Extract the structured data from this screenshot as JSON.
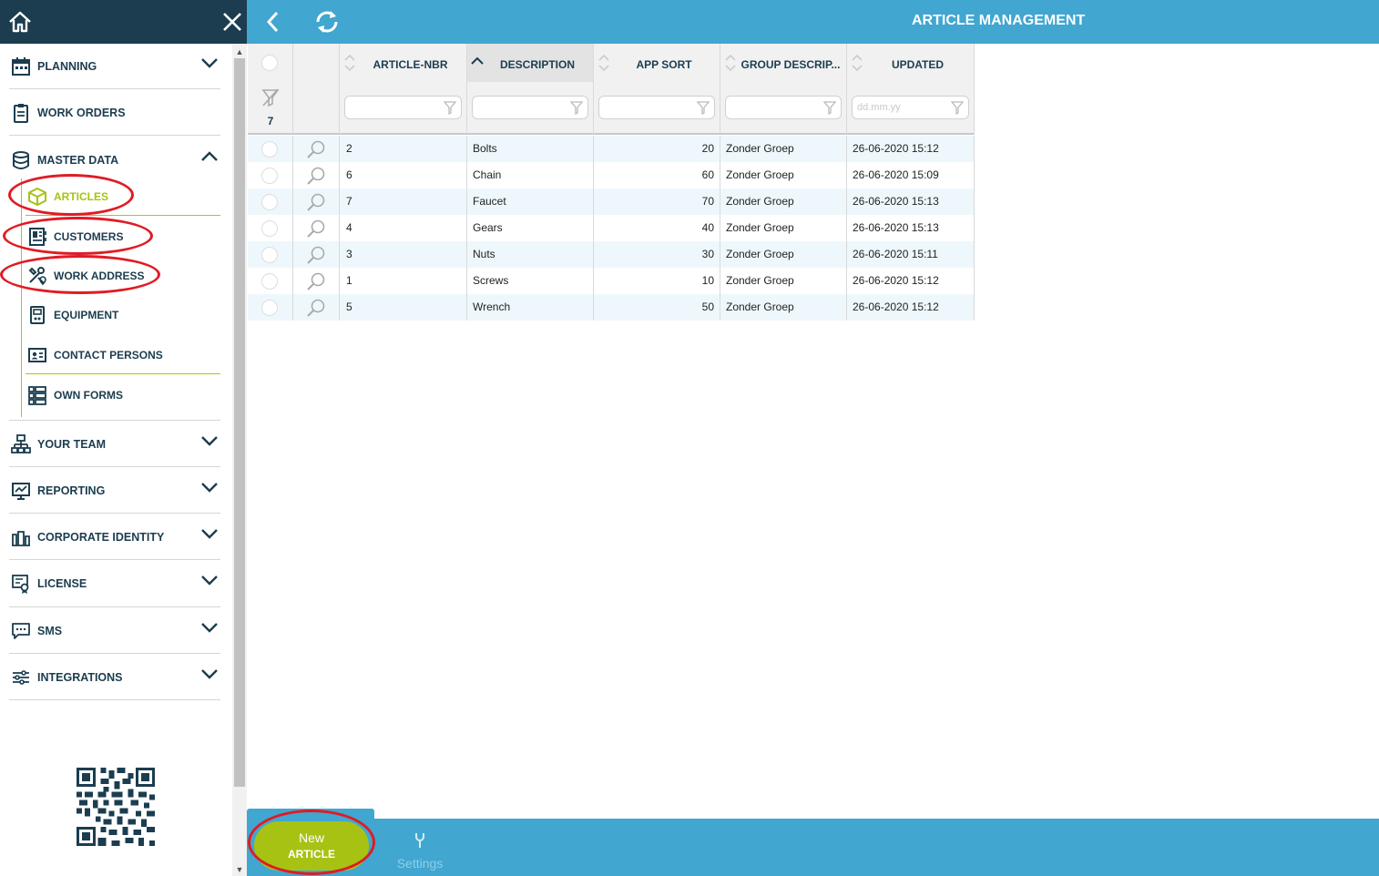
{
  "sidebar": {
    "items": [
      {
        "label": "PLANNING",
        "icon": "calendar-icon",
        "expandable": true
      },
      {
        "label": "WORK ORDERS",
        "icon": "clipboard-icon",
        "expandable": false
      },
      {
        "label": "MASTER DATA",
        "icon": "database-icon",
        "expanded": true,
        "children": [
          {
            "label": "ARTICLES",
            "icon": "box-icon",
            "active": true
          },
          {
            "label": "CUSTOMERS",
            "icon": "address-book-icon"
          },
          {
            "label": "WORK ADDRESS",
            "icon": "tools-location-icon"
          },
          {
            "label": "EQUIPMENT",
            "icon": "equipment-icon"
          },
          {
            "label": "CONTACT PERSONS",
            "icon": "id-card-icon"
          },
          {
            "label": "OWN FORMS",
            "icon": "list-icon"
          }
        ]
      },
      {
        "label": "YOUR TEAM",
        "icon": "org-chart-icon",
        "expandable": true
      },
      {
        "label": "REPORTING",
        "icon": "presentation-icon",
        "expandable": true
      },
      {
        "label": "CORPORATE IDENTITY",
        "icon": "brand-icon",
        "expandable": true
      },
      {
        "label": "LICENSE",
        "icon": "certificate-icon",
        "expandable": true
      },
      {
        "label": "SMS",
        "icon": "chat-icon",
        "expandable": true
      },
      {
        "label": "INTEGRATIONS",
        "icon": "sliders-icon",
        "expandable": true
      }
    ]
  },
  "header": {
    "title": "ARTICLE MANAGEMENT"
  },
  "grid": {
    "row_count": "7",
    "columns": [
      "ARTICLE-NBR",
      "DESCRIPTION",
      "APP SORT",
      "GROUP DESCRIP...",
      "UPDATED"
    ],
    "sorted_column": "DESCRIPTION",
    "filter_placeholders": [
      "",
      "",
      "",
      "",
      "dd.mm.yy"
    ],
    "rows": [
      {
        "nbr": "2",
        "description": "Bolts",
        "sort": "20",
        "group": "Zonder Groep",
        "updated": "26-06-2020 15:12"
      },
      {
        "nbr": "6",
        "description": "Chain",
        "sort": "60",
        "group": "Zonder Groep",
        "updated": "26-06-2020 15:09"
      },
      {
        "nbr": "7",
        "description": "Faucet",
        "sort": "70",
        "group": "Zonder Groep",
        "updated": "26-06-2020 15:13"
      },
      {
        "nbr": "4",
        "description": "Gears",
        "sort": "40",
        "group": "Zonder Groep",
        "updated": "26-06-2020 15:13"
      },
      {
        "nbr": "3",
        "description": "Nuts",
        "sort": "30",
        "group": "Zonder Groep",
        "updated": "26-06-2020 15:11"
      },
      {
        "nbr": "1",
        "description": "Screws",
        "sort": "10",
        "group": "Zonder Groep",
        "updated": "26-06-2020 15:12"
      },
      {
        "nbr": "5",
        "description": "Wrench",
        "sort": "50",
        "group": "Zonder Groep",
        "updated": "26-06-2020 15:12"
      }
    ]
  },
  "bottom": {
    "new_line1": "New",
    "new_line2": "ARTICLE",
    "settings_label": "Settings"
  },
  "colors": {
    "navy": "#1b3d4f",
    "blue": "#41a6d0",
    "lime": "#a8c213",
    "annotation_red": "#e01b24"
  }
}
